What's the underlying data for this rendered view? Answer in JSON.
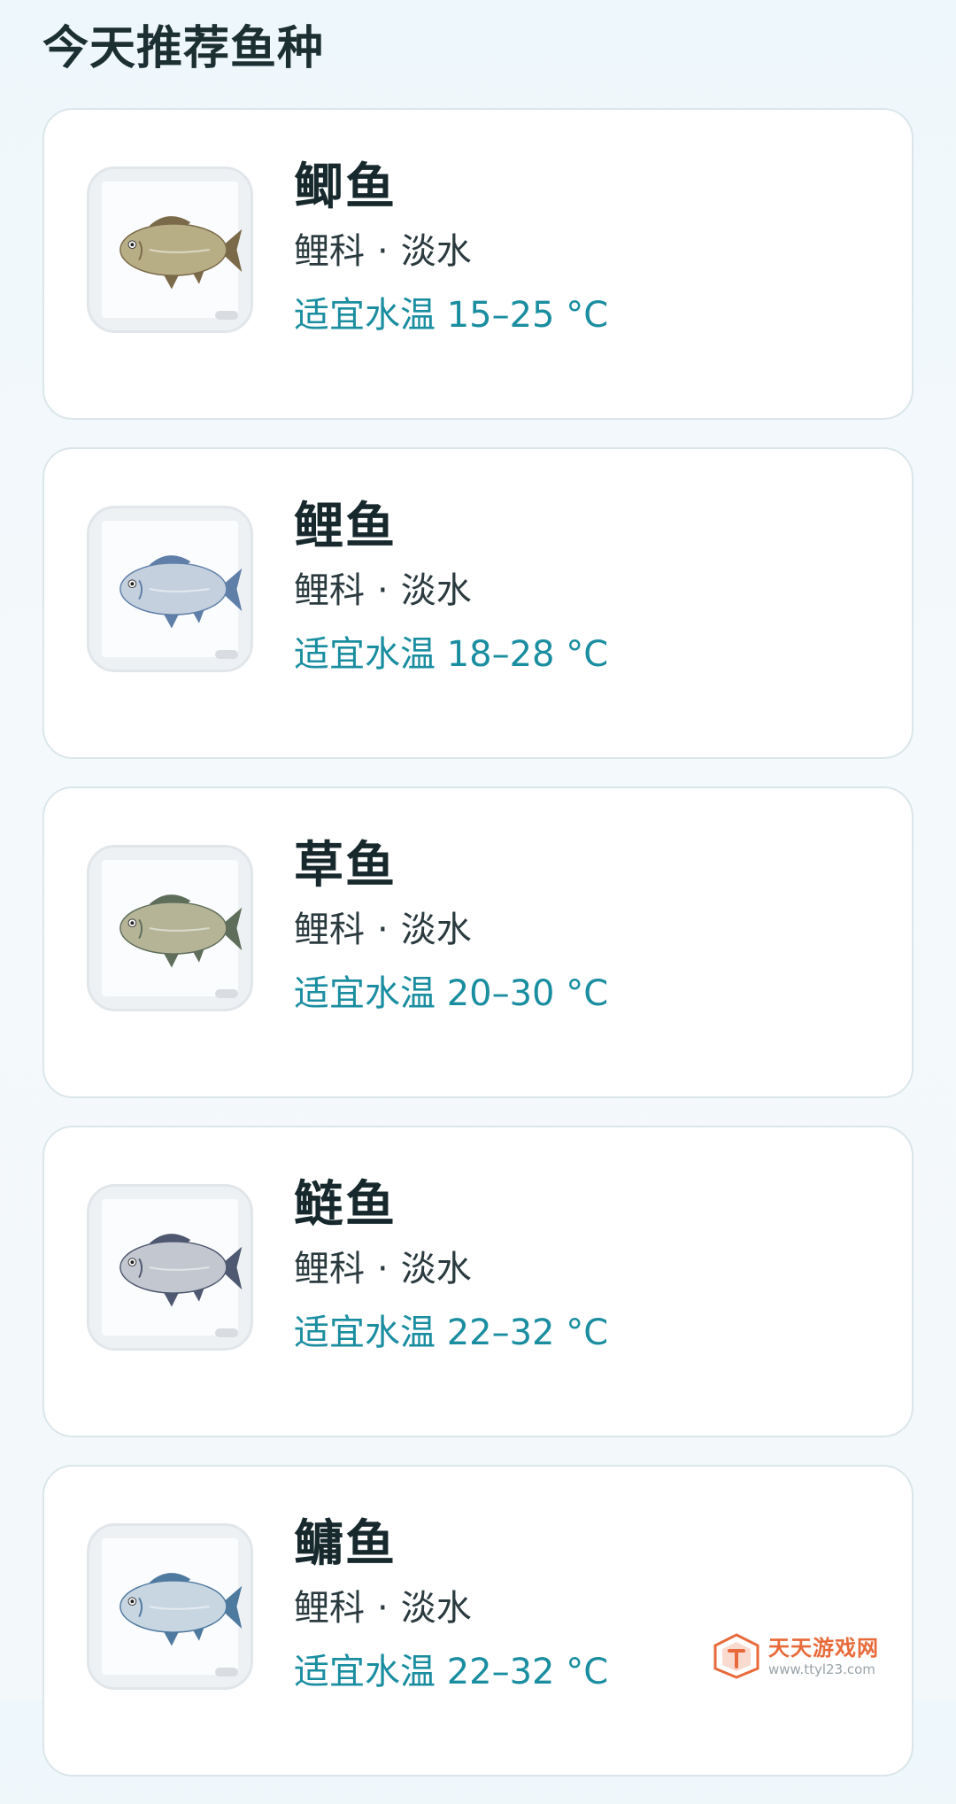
{
  "header": {
    "title": "今天推荐鱼种"
  },
  "fish_list": [
    {
      "name": "鲫鱼",
      "family": "鲤科",
      "separator": "·",
      "habitat": "淡水",
      "temp_label": "适宜水温 15–25 °C",
      "icon": "crucian-carp-image",
      "body_color": "#b8ae86",
      "fin_color": "#7b6a4a"
    },
    {
      "name": "鲤鱼",
      "family": "鲤科",
      "separator": "·",
      "habitat": "淡水",
      "temp_label": "适宜水温 18–28 °C",
      "icon": "carp-image",
      "body_color": "#c5d0de",
      "fin_color": "#5f7fa8"
    },
    {
      "name": "草鱼",
      "family": "鲤科",
      "separator": "·",
      "habitat": "淡水",
      "temp_label": "适宜水温 20–30 °C",
      "icon": "grass-carp-image",
      "body_color": "#b5b497",
      "fin_color": "#5f6e5a"
    },
    {
      "name": "鲢鱼",
      "family": "鲤科",
      "separator": "·",
      "habitat": "淡水",
      "temp_label": "适宜水温 22–32 °C",
      "icon": "silver-carp-image",
      "body_color": "#c3c7cf",
      "fin_color": "#4e5870"
    },
    {
      "name": "鳙鱼",
      "family": "鲤科",
      "separator": "·",
      "habitat": "淡水",
      "temp_label": "适宜水温 22–32 °C",
      "icon": "bighead-carp-image",
      "body_color": "#c8d6e2",
      "fin_color": "#4f7aa0"
    }
  ],
  "watermark": {
    "name": "天天游戏网",
    "url": "www.ttyl23.com",
    "color": "#e86a3a"
  },
  "colors": {
    "accent": "#1a8ea0",
    "title": "#1c2f33",
    "card_border": "#dbe6ea"
  }
}
